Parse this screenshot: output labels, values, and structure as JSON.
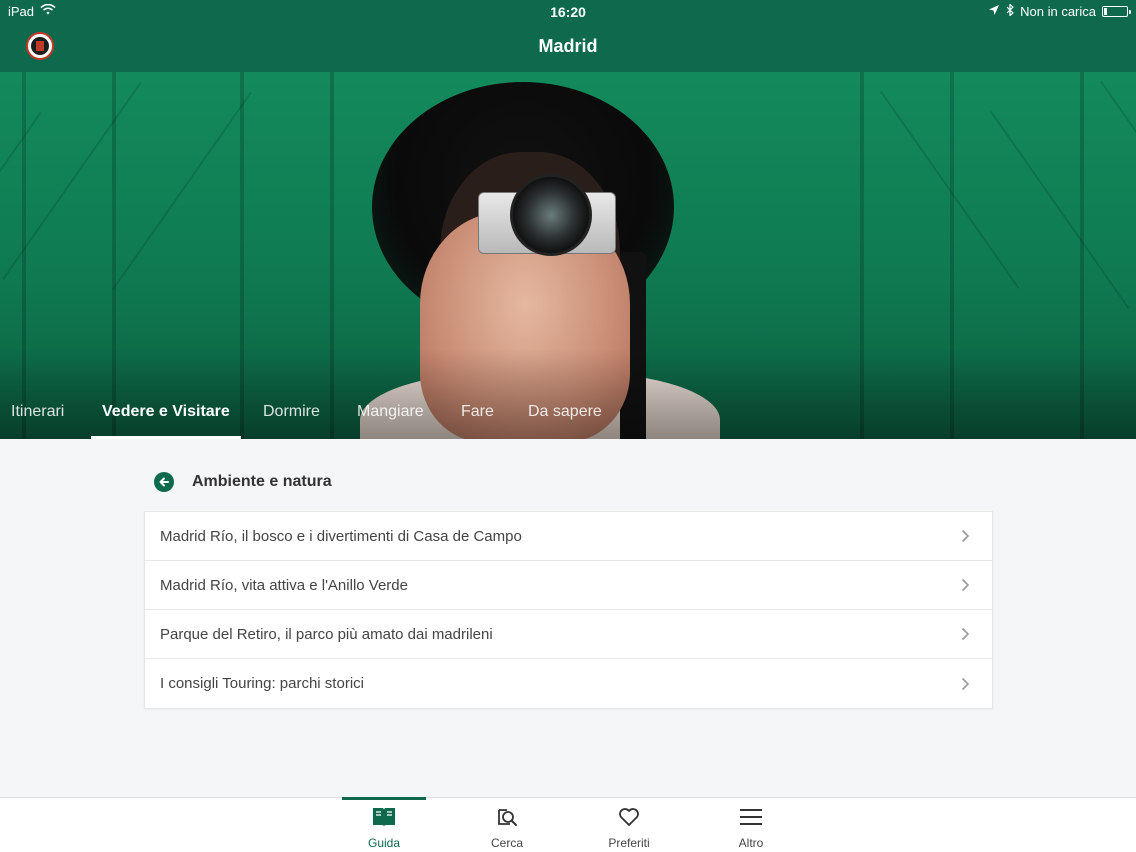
{
  "status_bar": {
    "device": "iPad",
    "time": "16:20",
    "charging": "Non in carica",
    "icons": [
      "wifi-icon",
      "location-icon",
      "bluetooth-icon",
      "battery-icon"
    ]
  },
  "header": {
    "title": "Madrid",
    "logo": "touring-logo-icon",
    "color": "#0f6a4d"
  },
  "tabs": [
    {
      "label": "Itinerari",
      "active": false
    },
    {
      "label": "Vedere e Visitare",
      "active": true
    },
    {
      "label": "Dormire",
      "active": false
    },
    {
      "label": "Mangiare",
      "active": false
    },
    {
      "label": "Fare",
      "active": false
    },
    {
      "label": "Da sapere",
      "active": false
    }
  ],
  "section": {
    "title": "Ambiente e natura",
    "back_icon": "back-arrow-icon"
  },
  "list": [
    {
      "label": "Madrid Río, il bosco e i divertimenti di Casa de Campo"
    },
    {
      "label": "Madrid Río, vita attiva e l'Anillo Verde"
    },
    {
      "label": "Parque del Retiro, il parco più amato dai madrileni"
    },
    {
      "label": "I consigli Touring: parchi storici"
    }
  ],
  "bottom_nav": [
    {
      "label": "Guida",
      "icon": "book-icon",
      "active": true
    },
    {
      "label": "Cerca",
      "icon": "search-icon",
      "active": false
    },
    {
      "label": "Preferiti",
      "icon": "heart-icon",
      "active": false
    },
    {
      "label": "Altro",
      "icon": "menu-icon",
      "active": false
    }
  ],
  "colors": {
    "accent": "#0f6a4d",
    "background": "#f5f6f7"
  }
}
